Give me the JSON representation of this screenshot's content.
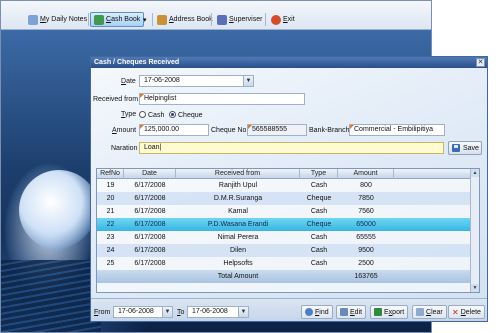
{
  "toolbar": {
    "items": [
      {
        "key": "M",
        "rest": "y Daily Notes",
        "icon": "notes-icon"
      },
      {
        "pre": "",
        "key": "C",
        "rest": "ash Book",
        "icon": "cash-book-icon"
      },
      {
        "pre": "",
        "key": "A",
        "rest": "ddress Book",
        "icon": "address-book-icon"
      },
      {
        "pre": "",
        "key": "S",
        "rest": "uperviser",
        "icon": "supervisor-icon"
      },
      {
        "pre": "",
        "key": "E",
        "rest": "xit",
        "icon": "exit-icon"
      }
    ],
    "dropdown_glyph": "▾"
  },
  "dialog": {
    "title": "Cash / Cheques Received",
    "close_glyph": "✕",
    "date": {
      "key": "D",
      "rest": "ate",
      "value": "17-06-2008"
    },
    "received_from": {
      "label": "Received from",
      "value": "Helpinglist"
    },
    "type": {
      "key": "T",
      "rest": "ype",
      "options": [
        "Cash",
        "Cheque"
      ],
      "selected": "Cheque"
    },
    "amount": {
      "key": "A",
      "rest": "mount",
      "value": "125,000.00"
    },
    "cheque_no": {
      "label": "Cheque No",
      "value": "565588555"
    },
    "bank_branch": {
      "label": "Bank-Branch",
      "value": "Commercial - Embilipitiya"
    },
    "naration": {
      "label": "Naration",
      "value": "Loan"
    },
    "save_label": "Save"
  },
  "grid": {
    "columns": [
      "RefNo",
      "Date",
      "Received from",
      "Type",
      "Amount"
    ],
    "rows": [
      {
        "ref": "19",
        "date": "6/17/2008",
        "from": "Ranjith Upul",
        "type": "Cash",
        "amount": "800"
      },
      {
        "ref": "20",
        "date": "6/17/2008",
        "from": "D.M.R.Suranga",
        "type": "Cheque",
        "amount": "7850"
      },
      {
        "ref": "21",
        "date": "6/17/2008",
        "from": "Kamal",
        "type": "Cash",
        "amount": "7560"
      },
      {
        "ref": "22",
        "date": "6/17/2008",
        "from": "P.D.Wasana Erandi",
        "type": "Cheque",
        "amount": "65000"
      },
      {
        "ref": "23",
        "date": "6/17/2008",
        "from": "Nimal Perera",
        "type": "Cash",
        "amount": "65555"
      },
      {
        "ref": "24",
        "date": "6/17/2008",
        "from": "Dilen",
        "type": "Cash",
        "amount": "9500"
      },
      {
        "ref": "25",
        "date": "6/17/2008",
        "from": "Helpsofts",
        "type": "Cash",
        "amount": "2500"
      }
    ],
    "selected_ref": "22",
    "total_label": "Total Amount",
    "total_value": "163765"
  },
  "footer": {
    "from": {
      "key": "F",
      "rest": "rom",
      "value": "17-06-2008"
    },
    "to": {
      "key": "T",
      "rest": "o",
      "value": "17-06-2008"
    },
    "buttons": [
      {
        "pre": "",
        "key": "F",
        "rest": "ind",
        "icon": "find-icon"
      },
      {
        "pre": "",
        "key": "E",
        "rest": "dit",
        "icon": "edit-icon"
      },
      {
        "pre": "E",
        "key": "x",
        "rest": "port",
        "icon": "export-icon"
      },
      {
        "pre": "",
        "key": "C",
        "rest": "lear",
        "icon": "clear-icon"
      },
      {
        "pre": "",
        "key": "D",
        "rest": "elete",
        "icon": "delete-icon"
      }
    ]
  },
  "colors": {
    "accent": "#2a4f8a",
    "selected_row": "#39b5e2",
    "note_field": "#fffbd0"
  }
}
